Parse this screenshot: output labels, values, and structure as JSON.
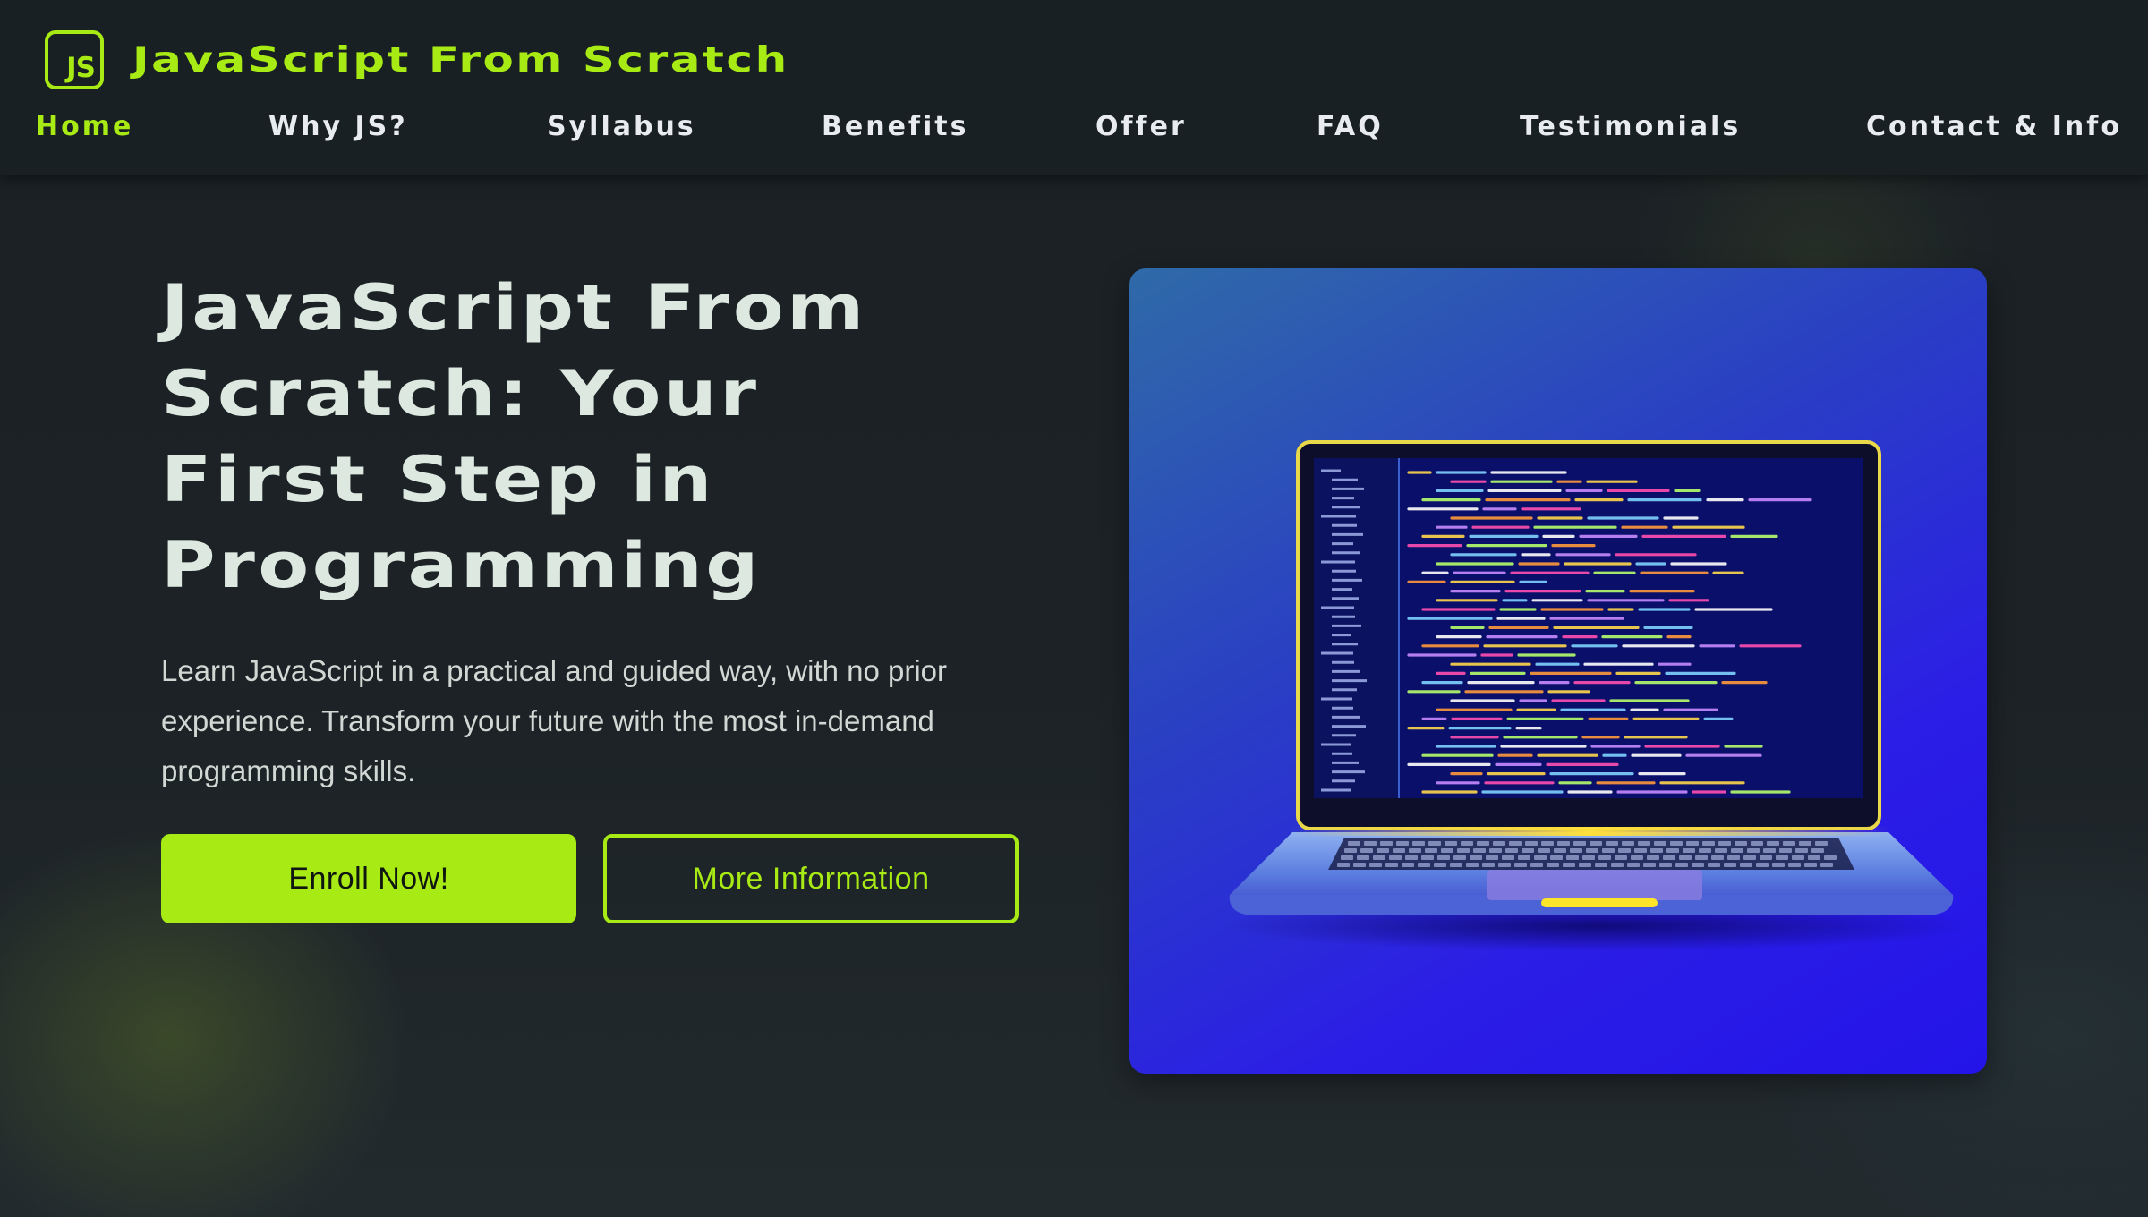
{
  "brand": {
    "logo_text": "JS",
    "name": "JavaScript From Scratch",
    "accent_color": "#a8ea14"
  },
  "nav": {
    "items": [
      {
        "label": "Home",
        "active": true
      },
      {
        "label": "Why JS?",
        "active": false
      },
      {
        "label": "Syllabus",
        "active": false
      },
      {
        "label": "Benefits",
        "active": false
      },
      {
        "label": "Offer",
        "active": false
      },
      {
        "label": "FAQ",
        "active": false
      },
      {
        "label": "Testimonials",
        "active": false
      },
      {
        "label": "Contact & Info",
        "active": false
      }
    ]
  },
  "hero": {
    "title_lines": [
      "JavaScript From",
      "Scratch: Your",
      "First Step in",
      "Programming"
    ],
    "description": "Learn JavaScript in a practical and guided way, with no prior experience. Transform your future with the most in-demand programming skills.",
    "primary_button": "Enroll Now!",
    "secondary_button": "More Information",
    "image_icon": "laptop-code-illustration"
  }
}
